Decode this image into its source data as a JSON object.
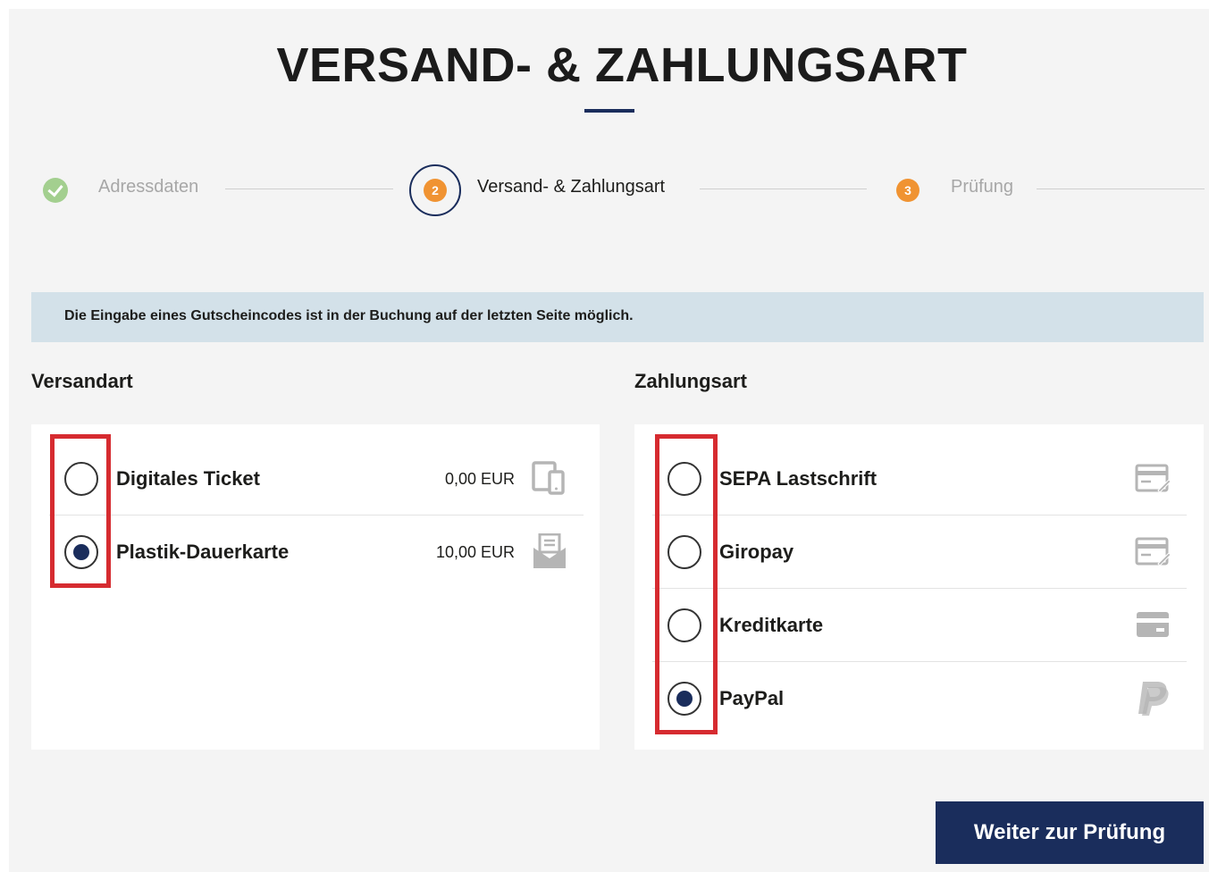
{
  "page": {
    "title": "VERSAND- & ZAHLUNGSART"
  },
  "steps": [
    {
      "number": "",
      "label": "Adressdaten",
      "state": "done"
    },
    {
      "number": "2",
      "label": "Versand- & Zahlungsart",
      "state": "active"
    },
    {
      "number": "3",
      "label": "Prüfung",
      "state": "upcoming"
    }
  ],
  "info": {
    "text": "Die Eingabe eines Gutscheincodes ist in der Buchung auf der letzten Seite möglich."
  },
  "shipping": {
    "heading": "Versandart",
    "options": [
      {
        "label": "Digitales Ticket",
        "price": "0,00 EUR",
        "icon": "mobile-device-icon",
        "selected": false
      },
      {
        "label": "Plastik-Dauerkarte",
        "price": "10,00 EUR",
        "icon": "envelope-letter-icon",
        "selected": true
      }
    ]
  },
  "payment": {
    "heading": "Zahlungsart",
    "options": [
      {
        "label": "SEPA Lastschrift",
        "icon": "sepa-form-icon",
        "selected": false
      },
      {
        "label": "Giropay",
        "icon": "giropay-form-icon",
        "selected": false
      },
      {
        "label": "Kreditkarte",
        "icon": "credit-card-icon",
        "selected": false
      },
      {
        "label": "PayPal",
        "icon": "paypal-icon",
        "selected": true
      }
    ]
  },
  "actions": {
    "continue_label": "Weiter zur Prüfung"
  },
  "colors": {
    "primary": "#1a2d5c",
    "step_orange": "#f09332",
    "step_done_green": "#a3cf8f",
    "info_bg": "#d3e1e9",
    "highlight_red": "#d62b30",
    "page_bg": "#f4f4f4"
  }
}
